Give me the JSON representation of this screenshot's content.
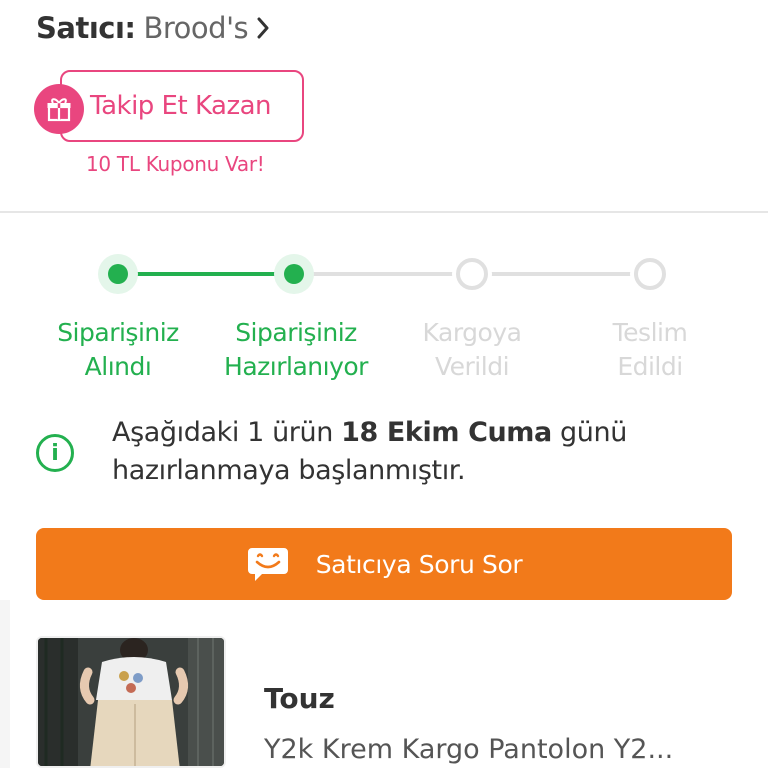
{
  "seller": {
    "label": "Satıcı:",
    "name": "Brood's"
  },
  "follow": {
    "button_label": "Takip Et Kazan",
    "coupon_text": "10 TL Kuponu Var!"
  },
  "order_steps": [
    {
      "label": "Siparişiniz\nAlındı",
      "status": "done"
    },
    {
      "label": "Siparişiniz\nHazırlanıyor",
      "status": "done"
    },
    {
      "label": "Kargoya\nVerildi",
      "status": "pending"
    },
    {
      "label": "Teslim\nEdildi",
      "status": "pending"
    }
  ],
  "info": {
    "text_before": "Aşağıdaki 1 ürün ",
    "highlight": "18 Ekim Cuma",
    "text_after": " günü hazırlanmaya başlanmıştır."
  },
  "ask_seller": {
    "label": "Satıcıya Soru Sor"
  },
  "product": {
    "brand": "Touz",
    "name": "Y2k Krem Kargo Pantolon Y2..."
  },
  "colors": {
    "accent_orange": "#f27a1a",
    "success_green": "#23b04f",
    "pink": "#e9467f"
  }
}
